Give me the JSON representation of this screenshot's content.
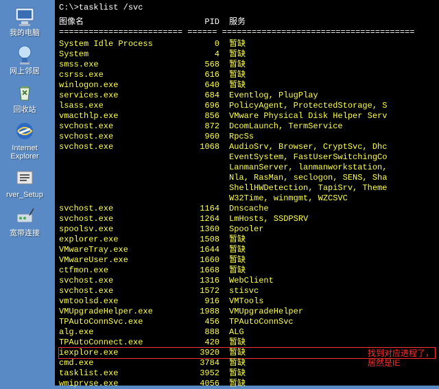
{
  "desktop": {
    "icons": [
      {
        "name": "my-computer",
        "label": "我的电脑",
        "glyph": "computer"
      },
      {
        "name": "network-places",
        "label": "网上邻居",
        "glyph": "network"
      },
      {
        "name": "recycle-bin",
        "label": "回收站",
        "glyph": "recycle"
      },
      {
        "name": "internet-explorer",
        "label": "Internet Explorer",
        "glyph": "ie"
      },
      {
        "name": "server-setup",
        "label": "rver_Setup",
        "glyph": "setup"
      },
      {
        "name": "broadband",
        "label": "宽带连接",
        "glyph": "modem"
      }
    ]
  },
  "terminal": {
    "command": "C:\\>tasklist /svc",
    "headers": {
      "image": "图像名",
      "pid": "PID",
      "service": "服务"
    },
    "divider": "========================= ====== =======================================",
    "rows": [
      {
        "image": "System Idle Process",
        "pid": "0",
        "svc": "暂缺"
      },
      {
        "image": "System",
        "pid": "4",
        "svc": "暂缺"
      },
      {
        "image": "smss.exe",
        "pid": "568",
        "svc": "暂缺"
      },
      {
        "image": "csrss.exe",
        "pid": "616",
        "svc": "暂缺"
      },
      {
        "image": "winlogon.exe",
        "pid": "640",
        "svc": "暂缺"
      },
      {
        "image": "services.exe",
        "pid": "684",
        "svc": "Eventlog, PlugPlay"
      },
      {
        "image": "lsass.exe",
        "pid": "696",
        "svc": "PolicyAgent, ProtectedStorage, S"
      },
      {
        "image": "vmacthlp.exe",
        "pid": "856",
        "svc": "VMware Physical Disk Helper Serv"
      },
      {
        "image": "svchost.exe",
        "pid": "872",
        "svc": "DcomLaunch, TermService"
      },
      {
        "image": "svchost.exe",
        "pid": "960",
        "svc": "RpcSs"
      },
      {
        "image": "svchost.exe",
        "pid": "1068",
        "svc": "AudioSrv, Browser, CryptSvc, Dhc"
      },
      {
        "image": "",
        "pid": "",
        "svc": "EventSystem, FastUserSwitchingCo"
      },
      {
        "image": "",
        "pid": "",
        "svc": "LanmanServer, lanmanworkstation,"
      },
      {
        "image": "",
        "pid": "",
        "svc": "Nla, RasMan, seclogon, SENS, Sha"
      },
      {
        "image": "",
        "pid": "",
        "svc": "ShellHWDetection, TapiSrv, Theme"
      },
      {
        "image": "",
        "pid": "",
        "svc": "W32Time, winmgmt, WZCSVC"
      },
      {
        "image": "svchost.exe",
        "pid": "1164",
        "svc": "Dnscache"
      },
      {
        "image": "svchost.exe",
        "pid": "1264",
        "svc": "LmHosts, SSDPSRV"
      },
      {
        "image": "spoolsv.exe",
        "pid": "1360",
        "svc": "Spooler"
      },
      {
        "image": "explorer.exe",
        "pid": "1508",
        "svc": "暂缺"
      },
      {
        "image": "VMwareTray.exe",
        "pid": "1644",
        "svc": "暂缺"
      },
      {
        "image": "VMwareUser.exe",
        "pid": "1660",
        "svc": "暂缺"
      },
      {
        "image": "ctfmon.exe",
        "pid": "1668",
        "svc": "暂缺"
      },
      {
        "image": "svchost.exe",
        "pid": "1316",
        "svc": "WebClient"
      },
      {
        "image": "svchost.exe",
        "pid": "1572",
        "svc": "stisvc"
      },
      {
        "image": "vmtoolsd.exe",
        "pid": "916",
        "svc": "VMTools"
      },
      {
        "image": "VMUpgradeHelper.exe",
        "pid": "1988",
        "svc": "VMUpgradeHelper"
      },
      {
        "image": "TPAutoConnSvc.exe",
        "pid": "456",
        "svc": "TPAutoConnSvc"
      },
      {
        "image": "alg.exe",
        "pid": "888",
        "svc": "ALG"
      },
      {
        "image": "TPAutoConnect.exe",
        "pid": "420",
        "svc": "暂缺"
      },
      {
        "image": "iexplore.exe",
        "pid": "3920",
        "svc": "暂缺",
        "highlight": true
      },
      {
        "image": "cmd.exe",
        "pid": "3784",
        "svc": "暂缺"
      },
      {
        "image": "tasklist.exe",
        "pid": "3952",
        "svc": "暂缺"
      },
      {
        "image": "wmiprvse.exe",
        "pid": "4056",
        "svc": "暂缺"
      }
    ],
    "annotation": "找到对应进程了，居然是IE"
  }
}
